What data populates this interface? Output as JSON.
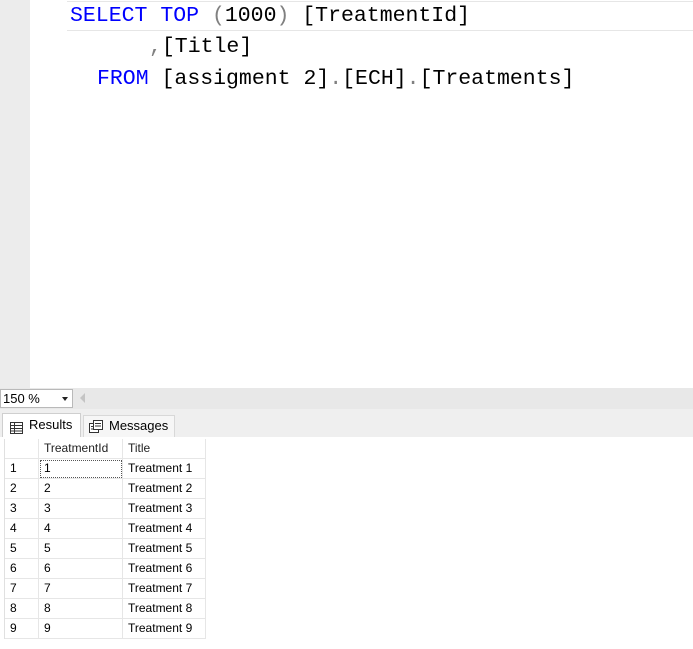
{
  "editor": {
    "line1": {
      "kw1": "SELECT",
      "kw2": "TOP",
      "paren_open": "(",
      "number": "1000",
      "paren_close": ")",
      "col1": "[TreatmentId]"
    },
    "line2": {
      "comma": ",",
      "col2": "[Title]"
    },
    "line3": {
      "kw": "FROM",
      "db": "[assigment 2]",
      "dot1": ".",
      "schema": "[ECH]",
      "dot2": ".",
      "table": "[Treatments]"
    }
  },
  "zoom": {
    "value": "150 %"
  },
  "tabs": {
    "results": "Results",
    "messages": "Messages"
  },
  "grid": {
    "headers": [
      "TreatmentId",
      "Title"
    ],
    "rows": [
      {
        "num": "1",
        "id": "1",
        "title": "Treatment 1"
      },
      {
        "num": "2",
        "id": "2",
        "title": "Treatment 2"
      },
      {
        "num": "3",
        "id": "3",
        "title": "Treatment 3"
      },
      {
        "num": "4",
        "id": "4",
        "title": "Treatment 4"
      },
      {
        "num": "5",
        "id": "5",
        "title": "Treatment 5"
      },
      {
        "num": "6",
        "id": "6",
        "title": "Treatment 6"
      },
      {
        "num": "7",
        "id": "7",
        "title": "Treatment 7"
      },
      {
        "num": "8",
        "id": "8",
        "title": "Treatment 8"
      },
      {
        "num": "9",
        "id": "9",
        "title": "Treatment 9"
      }
    ]
  },
  "colors": {
    "keyword": "#0000ff",
    "operator": "#808080",
    "text": "#000000"
  }
}
